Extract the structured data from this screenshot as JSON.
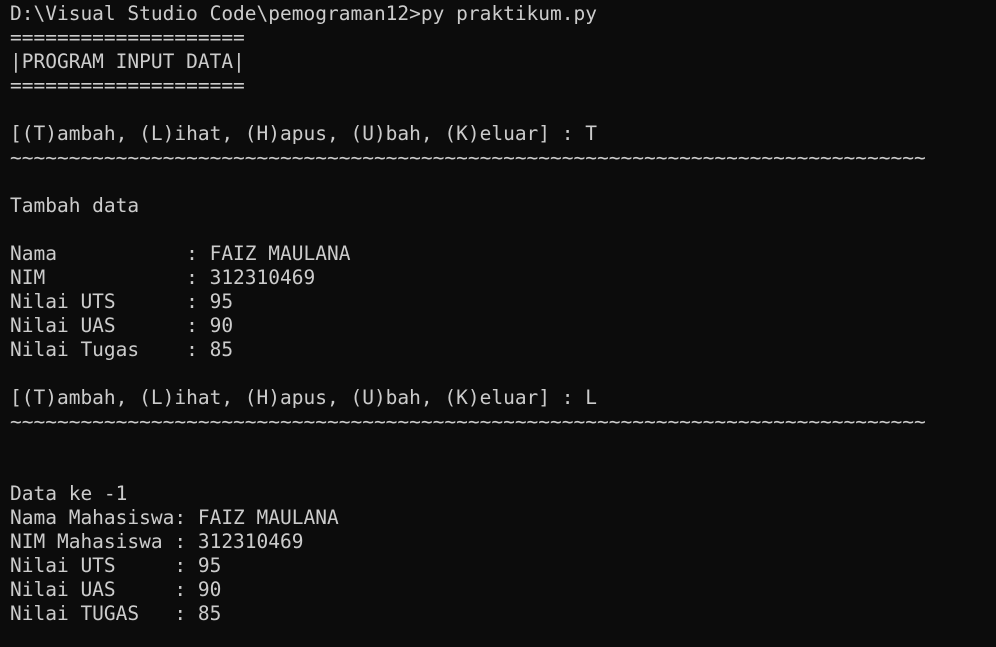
{
  "terminal": {
    "lines": [
      "D:\\Visual Studio Code\\pemograman12>py praktikum.py",
      "====================",
      "|PROGRAM INPUT DATA|",
      "====================",
      "",
      "[(T)ambah, (L)ihat, (H)apus, (U)bah, (K)eluar] : T",
      "~~~~~~~~~~~~~~~~~~~~~~~~~~~~~~~~~~~~~~~~~~~~~~~~~~~~~~~~~~~~~~~~~~~~~~~~~~~~~~",
      "",
      "Tambah data",
      "",
      "Nama           : FAIZ MAULANA",
      "NIM            : 312310469",
      "Nilai UTS      : 95",
      "Nilai UAS      : 90",
      "Nilai Tugas    : 85",
      "",
      "[(T)ambah, (L)ihat, (H)apus, (U)bah, (K)eluar] : L",
      "~~~~~~~~~~~~~~~~~~~~~~~~~~~~~~~~~~~~~~~~~~~~~~~~~~~~~~~~~~~~~~~~~~~~~~~~~~~~~~",
      "",
      "",
      "Data ke -1",
      "Nama Mahasiswa: FAIZ MAULANA",
      "NIM Mahasiswa : 312310469",
      "Nilai UTS     : 95",
      "Nilai UAS     : 90",
      "Nilai TUGAS   : 85"
    ]
  }
}
